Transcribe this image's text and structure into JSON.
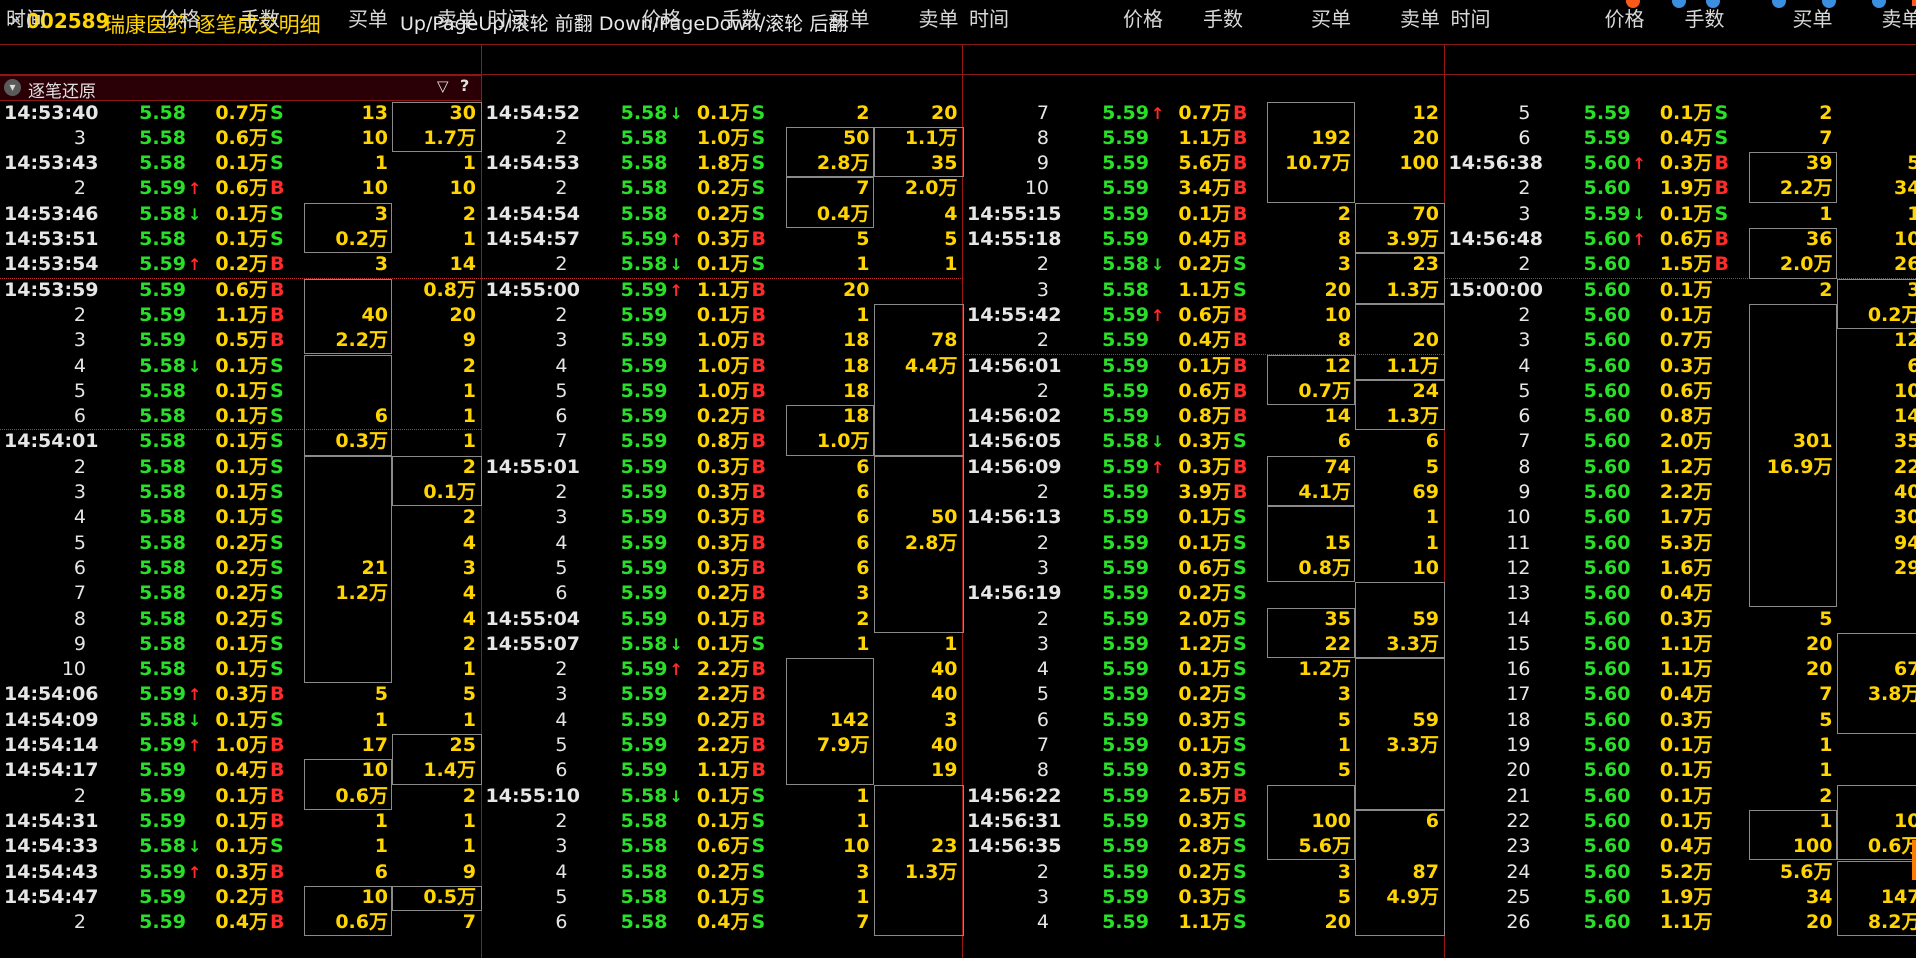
{
  "title": {
    "close_symbol": "×",
    "code": "002589",
    "name": "瑞康医药 逐笔成交明细",
    "hint": "Up/PageUp/滚轮 前翻 Down/PageDown/滚轮 后翻"
  },
  "headers": [
    "时间",
    "价格",
    "手数",
    "买单",
    "卖单"
  ],
  "restore_label": "逐笔还原",
  "icons": {
    "restore": "chevron-down-icon",
    "filter": "filter-icon",
    "help": "help-icon"
  },
  "colors": {
    "up": "#ff2a2a",
    "down": "#28e028",
    "flat": "#e6e6e6",
    "volume": "#ffd400",
    "buy": "#ff2a2a",
    "sell": "#28e028",
    "grid": "#9a1616"
  },
  "columns": [
    [
      {
        "t": "14:53:40",
        "p": "5.58",
        "v": "0.7万",
        "d": "S",
        "b": "13",
        "s": "30"
      },
      {
        "t": "3",
        "p": "5.58",
        "v": "0.6万",
        "d": "S",
        "b": "10",
        "s": "1.7万"
      },
      {
        "t": "14:53:43",
        "p": "5.58",
        "v": "0.1万",
        "d": "S",
        "b": "1",
        "s": "1"
      },
      {
        "t": "2",
        "p": "5.59",
        "a": "up",
        "v": "0.6万",
        "d": "B",
        "b": "10",
        "s": "10"
      },
      {
        "t": "14:53:46",
        "p": "5.58",
        "a": "down",
        "v": "0.1万",
        "d": "S",
        "b": "3",
        "s": "2"
      },
      {
        "t": "14:53:51",
        "p": "5.58",
        "v": "0.1万",
        "d": "S",
        "b": "0.2万",
        "s": "1"
      },
      {
        "t": "14:53:54",
        "p": "5.59",
        "a": "up",
        "v": "0.2万",
        "d": "B",
        "b": "3",
        "s": "14"
      },
      {
        "t": "14:53:59",
        "p": "5.59",
        "v": "0.6万",
        "d": "B",
        "b": "",
        "s": "0.8万"
      },
      {
        "t": "2",
        "p": "5.59",
        "v": "1.1万",
        "d": "B",
        "b": "40",
        "s": "20"
      },
      {
        "t": "3",
        "p": "5.59",
        "v": "0.5万",
        "d": "B",
        "b": "2.2万",
        "s": "9"
      },
      {
        "t": "4",
        "p": "5.58",
        "a": "down",
        "v": "0.1万",
        "d": "S",
        "b": "",
        "s": "2"
      },
      {
        "t": "5",
        "p": "5.58",
        "v": "0.1万",
        "d": "S",
        "b": "",
        "s": "1"
      },
      {
        "t": "6",
        "p": "5.58",
        "v": "0.1万",
        "d": "S",
        "b": "6",
        "s": "1"
      },
      {
        "t": "14:54:01",
        "p": "5.58",
        "v": "0.1万",
        "d": "S",
        "b": "0.3万",
        "s": "1"
      },
      {
        "t": "2",
        "p": "5.58",
        "v": "0.1万",
        "d": "S",
        "b": "",
        "s": "2"
      },
      {
        "t": "3",
        "p": "5.58",
        "v": "0.1万",
        "d": "S",
        "b": "",
        "s": "0.1万"
      },
      {
        "t": "4",
        "p": "5.58",
        "v": "0.1万",
        "d": "S",
        "b": "",
        "s": "2"
      },
      {
        "t": "5",
        "p": "5.58",
        "v": "0.2万",
        "d": "S",
        "b": "",
        "s": "4"
      },
      {
        "t": "6",
        "p": "5.58",
        "v": "0.2万",
        "d": "S",
        "b": "21",
        "s": "3"
      },
      {
        "t": "7",
        "p": "5.58",
        "v": "0.2万",
        "d": "S",
        "b": "1.2万",
        "s": "4"
      },
      {
        "t": "8",
        "p": "5.58",
        "v": "0.2万",
        "d": "S",
        "b": "",
        "s": "4"
      },
      {
        "t": "9",
        "p": "5.58",
        "v": "0.1万",
        "d": "S",
        "b": "",
        "s": "2"
      },
      {
        "t": "10",
        "p": "5.58",
        "v": "0.1万",
        "d": "S",
        "b": "",
        "s": "1"
      },
      {
        "t": "14:54:06",
        "p": "5.59",
        "a": "up",
        "v": "0.3万",
        "d": "B",
        "b": "5",
        "s": "5"
      },
      {
        "t": "14:54:09",
        "p": "5.58",
        "a": "down",
        "v": "0.1万",
        "d": "S",
        "b": "1",
        "s": "1"
      },
      {
        "t": "14:54:14",
        "p": "5.59",
        "a": "up",
        "v": "1.0万",
        "d": "B",
        "b": "17",
        "s": "25"
      },
      {
        "t": "14:54:17",
        "p": "5.59",
        "v": "0.4万",
        "d": "B",
        "b": "10",
        "s": "1.4万"
      },
      {
        "t": "2",
        "p": "5.59",
        "v": "0.1万",
        "d": "B",
        "b": "0.6万",
        "s": "2"
      },
      {
        "t": "14:54:31",
        "p": "5.59",
        "v": "0.1万",
        "d": "B",
        "b": "1",
        "s": "1"
      },
      {
        "t": "14:54:33",
        "p": "5.58",
        "a": "down",
        "v": "0.1万",
        "d": "S",
        "b": "1",
        "s": "1"
      },
      {
        "t": "14:54:43",
        "p": "5.59",
        "a": "up",
        "v": "0.3万",
        "d": "B",
        "b": "6",
        "s": "9"
      },
      {
        "t": "14:54:47",
        "p": "5.59",
        "v": "0.2万",
        "d": "B",
        "b": "10",
        "s": "0.5万"
      },
      {
        "t": "2",
        "p": "5.59",
        "v": "0.4万",
        "d": "B",
        "b": "0.6万",
        "s": "7"
      }
    ],
    [
      {
        "t": "14:54:52",
        "p": "5.58",
        "a": "down",
        "v": "0.1万",
        "d": "S",
        "b": "2",
        "s": "20"
      },
      {
        "t": "2",
        "p": "5.58",
        "v": "1.0万",
        "d": "S",
        "b": "50",
        "s": "1.1万"
      },
      {
        "t": "14:54:53",
        "p": "5.58",
        "v": "1.8万",
        "d": "S",
        "b": "2.8万",
        "s": "35"
      },
      {
        "t": "2",
        "p": "5.58",
        "v": "0.2万",
        "d": "S",
        "b": "7",
        "s": "2.0万"
      },
      {
        "t": "14:54:54",
        "p": "5.58",
        "v": "0.2万",
        "d": "S",
        "b": "0.4万",
        "s": "4"
      },
      {
        "t": "14:54:57",
        "p": "5.59",
        "a": "up",
        "v": "0.3万",
        "d": "B",
        "b": "5",
        "s": "5"
      },
      {
        "t": "2",
        "p": "5.58",
        "a": "down",
        "v": "0.1万",
        "d": "S",
        "b": "1",
        "s": "1"
      },
      {
        "t": "14:55:00",
        "p": "5.59",
        "a": "up",
        "v": "1.1万",
        "d": "B",
        "b": "20",
        "s": ""
      },
      {
        "t": "2",
        "p": "5.59",
        "v": "0.1万",
        "d": "B",
        "b": "1",
        "s": ""
      },
      {
        "t": "3",
        "p": "5.59",
        "v": "1.0万",
        "d": "B",
        "b": "18",
        "s": "78"
      },
      {
        "t": "4",
        "p": "5.59",
        "v": "1.0万",
        "d": "B",
        "b": "18",
        "s": "4.4万"
      },
      {
        "t": "5",
        "p": "5.59",
        "v": "1.0万",
        "d": "B",
        "b": "18",
        "s": ""
      },
      {
        "t": "6",
        "p": "5.59",
        "v": "0.2万",
        "d": "B",
        "b": "18",
        "s": ""
      },
      {
        "t": "7",
        "p": "5.59",
        "v": "0.8万",
        "d": "B",
        "b": "1.0万",
        "s": ""
      },
      {
        "t": "14:55:01",
        "p": "5.59",
        "v": "0.3万",
        "d": "B",
        "b": "6",
        "s": ""
      },
      {
        "t": "2",
        "p": "5.59",
        "v": "0.3万",
        "d": "B",
        "b": "6",
        "s": ""
      },
      {
        "t": "3",
        "p": "5.59",
        "v": "0.3万",
        "d": "B",
        "b": "6",
        "s": "50"
      },
      {
        "t": "4",
        "p": "5.59",
        "v": "0.3万",
        "d": "B",
        "b": "6",
        "s": "2.8万"
      },
      {
        "t": "5",
        "p": "5.59",
        "v": "0.3万",
        "d": "B",
        "b": "6",
        "s": ""
      },
      {
        "t": "6",
        "p": "5.59",
        "v": "0.2万",
        "d": "B",
        "b": "3",
        "s": ""
      },
      {
        "t": "14:55:04",
        "p": "5.59",
        "v": "0.1万",
        "d": "B",
        "b": "2",
        "s": ""
      },
      {
        "t": "14:55:07",
        "p": "5.58",
        "a": "down",
        "v": "0.1万",
        "d": "S",
        "b": "1",
        "s": "1"
      },
      {
        "t": "2",
        "p": "5.59",
        "a": "up",
        "v": "2.2万",
        "d": "B",
        "b": "",
        "s": "40"
      },
      {
        "t": "3",
        "p": "5.59",
        "v": "2.2万",
        "d": "B",
        "b": "",
        "s": "40"
      },
      {
        "t": "4",
        "p": "5.59",
        "v": "0.2万",
        "d": "B",
        "b": "142",
        "s": "3"
      },
      {
        "t": "5",
        "p": "5.59",
        "v": "2.2万",
        "d": "B",
        "b": "7.9万",
        "s": "40"
      },
      {
        "t": "6",
        "p": "5.59",
        "v": "1.1万",
        "d": "B",
        "b": "",
        "s": "19"
      },
      {
        "t": "14:55:10",
        "p": "5.58",
        "a": "down",
        "v": "0.1万",
        "d": "S",
        "b": "1",
        "s": ""
      },
      {
        "t": "2",
        "p": "5.58",
        "v": "0.1万",
        "d": "S",
        "b": "1",
        "s": ""
      },
      {
        "t": "3",
        "p": "5.58",
        "v": "0.6万",
        "d": "S",
        "b": "10",
        "s": "23"
      },
      {
        "t": "4",
        "p": "5.58",
        "v": "0.2万",
        "d": "S",
        "b": "3",
        "s": "1.3万"
      },
      {
        "t": "5",
        "p": "5.58",
        "v": "0.1万",
        "d": "S",
        "b": "1",
        "s": ""
      },
      {
        "t": "6",
        "p": "5.58",
        "v": "0.4万",
        "d": "S",
        "b": "7",
        "s": ""
      }
    ],
    [
      {
        "t": "7",
        "p": "5.59",
        "a": "up",
        "v": "0.7万",
        "d": "B",
        "b": "",
        "s": "12"
      },
      {
        "t": "8",
        "p": "5.59",
        "v": "1.1万",
        "d": "B",
        "b": "192",
        "s": "20"
      },
      {
        "t": "9",
        "p": "5.59",
        "v": "5.6万",
        "d": "B",
        "b": "10.7万",
        "s": "100"
      },
      {
        "t": "10",
        "p": "5.59",
        "v": "3.4万",
        "d": "B",
        "b": "",
        "s": ""
      },
      {
        "t": "14:55:15",
        "p": "5.59",
        "v": "0.1万",
        "d": "B",
        "b": "2",
        "s": "70"
      },
      {
        "t": "14:55:18",
        "p": "5.59",
        "v": "0.4万",
        "d": "B",
        "b": "8",
        "s": "3.9万"
      },
      {
        "t": "2",
        "p": "5.58",
        "a": "down",
        "v": "0.2万",
        "d": "S",
        "b": "3",
        "s": "23"
      },
      {
        "t": "3",
        "p": "5.58",
        "v": "1.1万",
        "d": "S",
        "b": "20",
        "s": "1.3万"
      },
      {
        "t": "14:55:42",
        "p": "5.59",
        "a": "up",
        "v": "0.6万",
        "d": "B",
        "b": "10",
        "s": ""
      },
      {
        "t": "2",
        "p": "5.59",
        "v": "0.4万",
        "d": "B",
        "b": "8",
        "s": "20"
      },
      {
        "t": "14:56:01",
        "p": "5.59",
        "v": "0.1万",
        "d": "B",
        "b": "12",
        "s": "1.1万"
      },
      {
        "t": "2",
        "p": "5.59",
        "v": "0.6万",
        "d": "B",
        "b": "0.7万",
        "s": "24"
      },
      {
        "t": "14:56:02",
        "p": "5.59",
        "v": "0.8万",
        "d": "B",
        "b": "14",
        "s": "1.3万"
      },
      {
        "t": "14:56:05",
        "p": "5.58",
        "a": "down",
        "v": "0.3万",
        "d": "S",
        "b": "6",
        "s": "6"
      },
      {
        "t": "14:56:09",
        "p": "5.59",
        "a": "up",
        "v": "0.3万",
        "d": "B",
        "b": "74",
        "s": "5"
      },
      {
        "t": "2",
        "p": "5.59",
        "v": "3.9万",
        "d": "B",
        "b": "4.1万",
        "s": "69"
      },
      {
        "t": "14:56:13",
        "p": "5.59",
        "v": "0.1万",
        "d": "S",
        "b": "",
        "s": "1"
      },
      {
        "t": "2",
        "p": "5.59",
        "v": "0.1万",
        "d": "S",
        "b": "15",
        "s": "1"
      },
      {
        "t": "3",
        "p": "5.59",
        "v": "0.6万",
        "d": "S",
        "b": "0.8万",
        "s": "10"
      },
      {
        "t": "14:56:19",
        "p": "5.59",
        "v": "0.2万",
        "d": "S",
        "b": "",
        "s": ""
      },
      {
        "t": "2",
        "p": "5.59",
        "v": "2.0万",
        "d": "S",
        "b": "35",
        "s": "59"
      },
      {
        "t": "3",
        "p": "5.59",
        "v": "1.2万",
        "d": "S",
        "b": "22",
        "s": "3.3万"
      },
      {
        "t": "4",
        "p": "5.59",
        "v": "0.1万",
        "d": "S",
        "b": "1.2万",
        "s": ""
      },
      {
        "t": "5",
        "p": "5.59",
        "v": "0.2万",
        "d": "S",
        "b": "3",
        "s": ""
      },
      {
        "t": "6",
        "p": "5.59",
        "v": "0.3万",
        "d": "S",
        "b": "5",
        "s": "59"
      },
      {
        "t": "7",
        "p": "5.59",
        "v": "0.1万",
        "d": "S",
        "b": "1",
        "s": "3.3万"
      },
      {
        "t": "8",
        "p": "5.59",
        "v": "0.3万",
        "d": "S",
        "b": "5",
        "s": ""
      },
      {
        "t": "14:56:22",
        "p": "5.59",
        "v": "2.5万",
        "d": "B",
        "b": "",
        "s": ""
      },
      {
        "t": "14:56:31",
        "p": "5.59",
        "v": "0.3万",
        "d": "S",
        "b": "100",
        "s": "6"
      },
      {
        "t": "14:56:35",
        "p": "5.59",
        "v": "2.8万",
        "d": "S",
        "b": "5.6万",
        "s": ""
      },
      {
        "t": "2",
        "p": "5.59",
        "v": "0.2万",
        "d": "S",
        "b": "3",
        "s": "87"
      },
      {
        "t": "3",
        "p": "5.59",
        "v": "0.3万",
        "d": "S",
        "b": "5",
        "s": "4.9万"
      },
      {
        "t": "4",
        "p": "5.59",
        "v": "1.1万",
        "d": "S",
        "b": "20",
        "s": ""
      }
    ],
    [
      {
        "t": "5",
        "p": "5.59",
        "v": "0.1万",
        "d": "S",
        "b": "2",
        "s": ""
      },
      {
        "t": "6",
        "p": "5.59",
        "v": "0.4万",
        "d": "S",
        "b": "7",
        "s": ""
      },
      {
        "t": "14:56:38",
        "p": "5.60",
        "a": "up",
        "v": "0.3万",
        "d": "B",
        "b": "39",
        "s": "5"
      },
      {
        "t": "2",
        "p": "5.60",
        "v": "1.9万",
        "d": "B",
        "b": "2.2万",
        "s": "34"
      },
      {
        "t": "3",
        "p": "5.59",
        "a": "down",
        "v": "0.1万",
        "d": "S",
        "b": "1",
        "s": "1"
      },
      {
        "t": "14:56:48",
        "p": "5.60",
        "a": "up",
        "v": "0.6万",
        "d": "B",
        "b": "36",
        "s": "10"
      },
      {
        "t": "2",
        "p": "5.60",
        "v": "1.5万",
        "d": "B",
        "b": "2.0万",
        "s": "26"
      },
      {
        "t": "15:00:00",
        "p": "5.60",
        "v": "0.1万",
        "d": "",
        "b": "2",
        "s": "3"
      },
      {
        "t": "2",
        "p": "5.60",
        "v": "0.1万",
        "d": "",
        "b": "",
        "s": "0.2万"
      },
      {
        "t": "3",
        "p": "5.60",
        "v": "0.7万",
        "d": "",
        "b": "",
        "s": "12"
      },
      {
        "t": "4",
        "p": "5.60",
        "v": "0.3万",
        "d": "",
        "b": "",
        "s": "6"
      },
      {
        "t": "5",
        "p": "5.60",
        "v": "0.6万",
        "d": "",
        "b": "",
        "s": "10"
      },
      {
        "t": "6",
        "p": "5.60",
        "v": "0.8万",
        "d": "",
        "b": "",
        "s": "14"
      },
      {
        "t": "7",
        "p": "5.60",
        "v": "2.0万",
        "d": "",
        "b": "301",
        "s": "35"
      },
      {
        "t": "8",
        "p": "5.60",
        "v": "1.2万",
        "d": "",
        "b": "16.9万",
        "s": "22"
      },
      {
        "t": "9",
        "p": "5.60",
        "v": "2.2万",
        "d": "",
        "b": "",
        "s": "40"
      },
      {
        "t": "10",
        "p": "5.60",
        "v": "1.7万",
        "d": "",
        "b": "",
        "s": "30"
      },
      {
        "t": "11",
        "p": "5.60",
        "v": "5.3万",
        "d": "",
        "b": "",
        "s": "94"
      },
      {
        "t": "12",
        "p": "5.60",
        "v": "1.6万",
        "d": "",
        "b": "",
        "s": "29"
      },
      {
        "t": "13",
        "p": "5.60",
        "v": "0.4万",
        "d": "",
        "b": "",
        "s": ""
      },
      {
        "t": "14",
        "p": "5.60",
        "v": "0.3万",
        "d": "",
        "b": "5",
        "s": ""
      },
      {
        "t": "15",
        "p": "5.60",
        "v": "1.1万",
        "d": "",
        "b": "20",
        "s": ""
      },
      {
        "t": "16",
        "p": "5.60",
        "v": "1.1万",
        "d": "",
        "b": "20",
        "s": "67"
      },
      {
        "t": "17",
        "p": "5.60",
        "v": "0.4万",
        "d": "",
        "b": "7",
        "s": "3.8万"
      },
      {
        "t": "18",
        "p": "5.60",
        "v": "0.3万",
        "d": "",
        "b": "5",
        "s": ""
      },
      {
        "t": "19",
        "p": "5.60",
        "v": "0.1万",
        "d": "",
        "b": "1",
        "s": ""
      },
      {
        "t": "20",
        "p": "5.60",
        "v": "0.1万",
        "d": "",
        "b": "1",
        "s": ""
      },
      {
        "t": "21",
        "p": "5.60",
        "v": "0.1万",
        "d": "",
        "b": "2",
        "s": ""
      },
      {
        "t": "22",
        "p": "5.60",
        "v": "0.1万",
        "d": "",
        "b": "1",
        "s": "10"
      },
      {
        "t": "23",
        "p": "5.60",
        "v": "0.4万",
        "d": "",
        "b": "100",
        "s": "0.6万"
      },
      {
        "t": "24",
        "p": "5.60",
        "v": "5.2万",
        "d": "",
        "b": "5.6万",
        "s": ""
      },
      {
        "t": "25",
        "p": "5.60",
        "v": "1.9万",
        "d": "",
        "b": "34",
        "s": "147"
      },
      {
        "t": "26",
        "p": "5.60",
        "v": "1.1万",
        "d": "",
        "b": "20",
        "s": "8.2万"
      }
    ]
  ]
}
